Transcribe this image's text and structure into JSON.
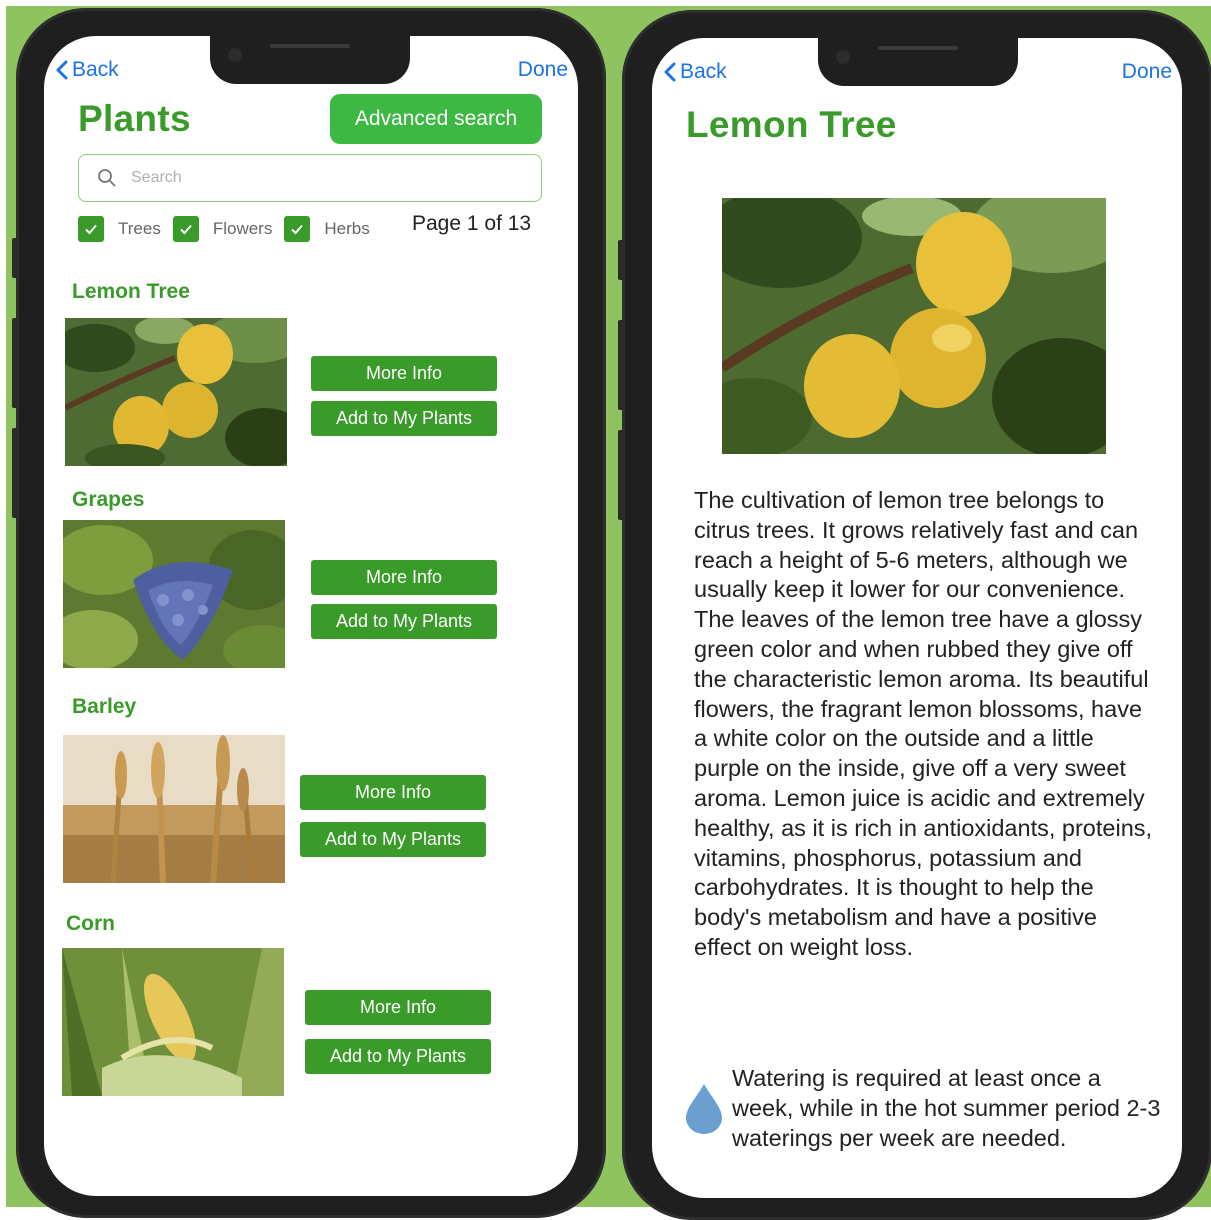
{
  "colors": {
    "background": "#8fc35f",
    "accent_green": "#3a9a2a",
    "button_green": "#3db843",
    "link_blue": "#1a73e8",
    "water_drop": "#6a9fd0"
  },
  "left_screen": {
    "nav": {
      "back_label": "Back",
      "done_label": "Done"
    },
    "title": "Plants",
    "advanced_search_label": "Advanced search",
    "search": {
      "placeholder": "Search",
      "value": ""
    },
    "filters": [
      {
        "label": "Trees",
        "checked": true
      },
      {
        "label": "Flowers",
        "checked": true
      },
      {
        "label": "Herbs",
        "checked": true
      }
    ],
    "page_indicator": "Page 1 of 13",
    "items": [
      {
        "name": "Lemon Tree",
        "image": "lemon-tree-photo",
        "more_info_label": "More Info",
        "add_label": "Add to My Plants"
      },
      {
        "name": "Grapes",
        "image": "grapes-photo",
        "more_info_label": "More Info",
        "add_label": "Add to My Plants"
      },
      {
        "name": "Barley",
        "image": "barley-photo",
        "more_info_label": "More Info",
        "add_label": "Add to My Plants"
      },
      {
        "name": "Corn",
        "image": "corn-photo",
        "more_info_label": "More Info",
        "add_label": "Add to My Plants"
      }
    ]
  },
  "right_screen": {
    "nav": {
      "back_label": "Back",
      "done_label": "Done"
    },
    "title": "Lemon Tree",
    "image": "lemon-tree-photo",
    "description": "The cultivation of lemon tree belongs to citrus trees. It grows relatively fast and can reach a height of 5-6 meters, although we usually keep it lower for our convenience. The leaves of the lemon tree have a glossy green color and when rubbed they give off the characteristic lemon aroma. Its beautiful flowers, the fragrant lemon blossoms, have a white color on the outside and a little purple on the inside, give off a very sweet aroma. Lemon juice is acidic and extremely healthy, as it is rich in antioxidants, proteins, vitamins, phosphorus, potassium and carbohydrates. It is thought to help the body's metabolism and have a positive effect on weight loss.",
    "watering": {
      "icon": "water-drop-icon",
      "text": "Watering is required at least once a week, while in the hot summer period 2-3 waterings per week are needed."
    }
  }
}
